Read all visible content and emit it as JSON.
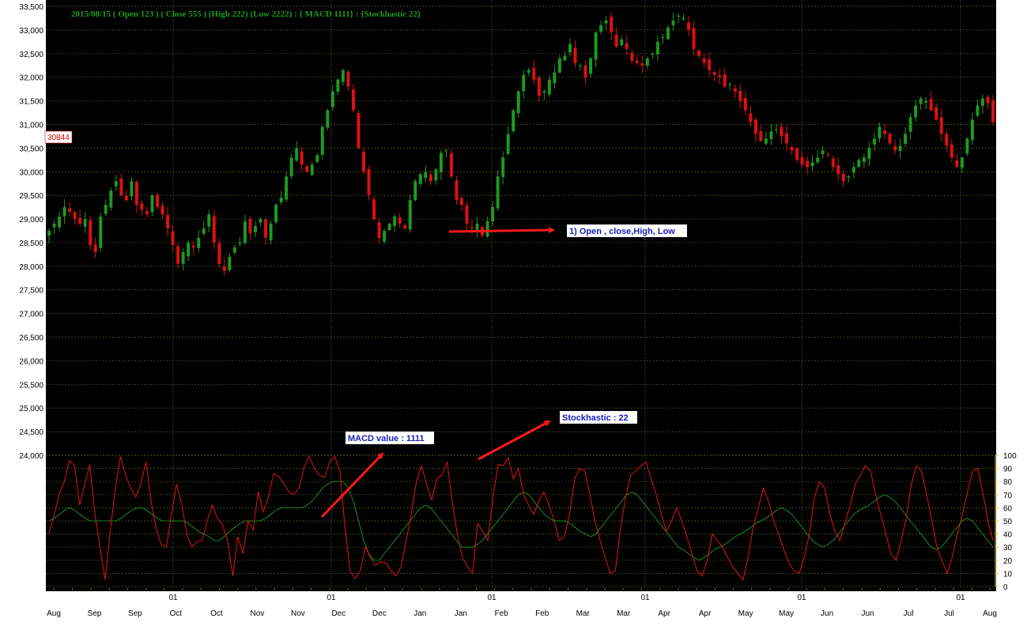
{
  "header": {
    "info_line": "2015/08/15 ( Open 123 ) ( Close 555 ) (High 222) (Low 2222) : { MACD 1111} : {Stockhastic 22}"
  },
  "current_price_badge": "30844",
  "annotations": {
    "ohlc_note": "1) Open , close,High, Low",
    "macd_note": "MACD value : 1111",
    "stoch_note": "Stockhastic : 22"
  },
  "colors": {
    "background": "#000000",
    "grid": "#5a5a28",
    "month_divider": "#6e6e6e",
    "up": "#1f9a1f",
    "down": "#e01010",
    "macd_line": "#e01515",
    "stoch_line": "#1e8a1e",
    "arrow": "#ff1a1a",
    "osc_axis": "#d8c838"
  },
  "chart_data": [
    {
      "type": "candlestick",
      "title": "",
      "ylim": [
        24000,
        33500
      ],
      "y_ticks": [
        "24,000",
        "24,500",
        "25,000",
        "25,500",
        "26,000",
        "26,500",
        "27,000",
        "27,500",
        "28,000",
        "28,500",
        "29,000",
        "29,500",
        "30,000",
        "30,500",
        "31,000",
        "31,500",
        "32,000",
        "32,500",
        "33,000",
        "33,500"
      ],
      "x_tick_labels": [
        "Aug",
        "Sep",
        "Sep",
        "Oct",
        "Oct",
        "Nov",
        "Nov",
        "Dec",
        "Dec",
        "Jan",
        "Jan",
        "Feb",
        "Feb",
        "Mar",
        "Mar",
        "Apr",
        "Apr",
        "May",
        "May",
        "Jun",
        "Jun",
        "Jul",
        "Jul",
        "Aug"
      ],
      "month_start_labels": [
        "01",
        "01",
        "01",
        "01",
        "01",
        "01"
      ],
      "series": [
        {
          "name": "",
          "close": [
            28750,
            28900,
            29050,
            29250,
            29150,
            29000,
            28900,
            29000,
            28450,
            28300,
            29050,
            29300,
            29600,
            29800,
            29500,
            29400,
            29800,
            29300,
            29200,
            29100,
            29500,
            29250,
            29100,
            28800,
            28450,
            28050,
            28300,
            28500,
            28400,
            28600,
            28800,
            29100,
            28500,
            28050,
            27900,
            28200,
            28400,
            28500,
            28950,
            28700,
            28850,
            29000,
            28600,
            28900,
            29300,
            29450,
            29900,
            30300,
            30500,
            30150,
            30000,
            30150,
            30350,
            30950,
            31300,
            31700,
            31950,
            32150,
            31800,
            31300,
            30500,
            30000,
            29500,
            29000,
            28600,
            28750,
            28900,
            29050,
            28900,
            28800,
            29400,
            29800,
            29950,
            30000,
            29800,
            30050,
            30400,
            30450,
            29900,
            29400,
            29300,
            28900,
            28800,
            28900,
            28650,
            28950,
            29250,
            29900,
            30300,
            30800,
            31300,
            31700,
            32050,
            32150,
            31950,
            31600,
            31700,
            31950,
            32100,
            32400,
            32450,
            32700,
            32300,
            32250,
            32000,
            32400,
            32950,
            33100,
            33200,
            32950,
            32650,
            32800,
            32600,
            32350,
            32300,
            32250,
            32400,
            32500,
            32750,
            32850,
            33050,
            33200,
            33300,
            33250,
            33000,
            32600,
            32450,
            32300,
            32150,
            32050,
            32000,
            31800,
            31850,
            31700,
            31500,
            31300,
            31050,
            30800,
            30650,
            30700,
            30850,
            30900,
            30750,
            30600,
            30450,
            30250,
            30150,
            30100,
            30200,
            30300,
            30450,
            30350,
            30100,
            29950,
            29800,
            29900,
            30100,
            30250,
            30300,
            30500,
            30700,
            30950,
            30800,
            30600,
            30450,
            30550,
            30800,
            31150,
            31400,
            31550,
            31500,
            31300,
            31100,
            30800,
            30550,
            30300,
            30100,
            30300,
            30700,
            31100,
            31400,
            31550,
            31450,
            31050
          ]
        }
      ]
    },
    {
      "type": "line",
      "title": "",
      "ylim": [
        0,
        100
      ],
      "y_ticks": [
        "0",
        "10",
        "20",
        "30",
        "40",
        "50",
        "60",
        "70",
        "80",
        "90",
        "100"
      ],
      "series": [
        {
          "name": "",
          "values": [
            40,
            55,
            70,
            80,
            96,
            92,
            62,
            78,
            93,
            55,
            30,
            5,
            42,
            75,
            99,
            85,
            75,
            68,
            78,
            95,
            65,
            44,
            32,
            30,
            55,
            78,
            63,
            40,
            30,
            34,
            35,
            50,
            62,
            52,
            47,
            35,
            8,
            38,
            25,
            50,
            43,
            72,
            57,
            68,
            86,
            84,
            79,
            72,
            70,
            75,
            91,
            99,
            90,
            85,
            83,
            95,
            99,
            88,
            45,
            12,
            6,
            12,
            30,
            22,
            16,
            19,
            18,
            12,
            8,
            15,
            35,
            55,
            80,
            92,
            78,
            66,
            82,
            85,
            95,
            65,
            40,
            22,
            15,
            10,
            48,
            42,
            35,
            68,
            93,
            92,
            98,
            82,
            90,
            70,
            62,
            55,
            65,
            72,
            62,
            50,
            35,
            38,
            55,
            82,
            90,
            88,
            70,
            50,
            35,
            22,
            10,
            12,
            45,
            68,
            85,
            88,
            92,
            95,
            82,
            70,
            55,
            42,
            50,
            60,
            50,
            38,
            25,
            12,
            8,
            20,
            40,
            35,
            30,
            22,
            15,
            10,
            5,
            22,
            45,
            60,
            75,
            65,
            50,
            40,
            28,
            18,
            12,
            10,
            22,
            40,
            68,
            80,
            75,
            56,
            42,
            35,
            48,
            62,
            78,
            85,
            92,
            88,
            70,
            55,
            40,
            25,
            20,
            35,
            52,
            78,
            92,
            88,
            70,
            50,
            30,
            20,
            10,
            22,
            40,
            55,
            72,
            88,
            90,
            72,
            50,
            35
          ]
        },
        {
          "name": "",
          "values": [
            50,
            52,
            55,
            58,
            60,
            58,
            55,
            52,
            50,
            50,
            50,
            50,
            50,
            50,
            52,
            55,
            58,
            60,
            60,
            58,
            55,
            52,
            50,
            50,
            50,
            50,
            50,
            48,
            45,
            42,
            40,
            38,
            35,
            35,
            38,
            42,
            45,
            48,
            50,
            50,
            50,
            50,
            52,
            55,
            58,
            60,
            60,
            60,
            60,
            60,
            62,
            65,
            70,
            75,
            78,
            80,
            80,
            80,
            75,
            65,
            50,
            35,
            25,
            20,
            20,
            25,
            30,
            35,
            40,
            45,
            50,
            55,
            60,
            62,
            60,
            55,
            50,
            45,
            40,
            35,
            30,
            30,
            30,
            32,
            35,
            40,
            45,
            50,
            55,
            60,
            65,
            70,
            72,
            70,
            65,
            60,
            55,
            52,
            50,
            50,
            50,
            48,
            45,
            42,
            40,
            38,
            40,
            45,
            50,
            55,
            60,
            65,
            70,
            72,
            70,
            65,
            60,
            55,
            50,
            45,
            40,
            35,
            30,
            28,
            25,
            22,
            20,
            22,
            25,
            28,
            30,
            32,
            35,
            38,
            40,
            42,
            45,
            48,
            50,
            52,
            55,
            58,
            60,
            58,
            55,
            50,
            45,
            40,
            35,
            32,
            30,
            32,
            35,
            40,
            45,
            50,
            55,
            58,
            60,
            62,
            65,
            68,
            70,
            68,
            65,
            60,
            55,
            50,
            45,
            40,
            35,
            30,
            28,
            30,
            35,
            40,
            45,
            50,
            52,
            50,
            45,
            40,
            35,
            30
          ]
        }
      ]
    }
  ]
}
